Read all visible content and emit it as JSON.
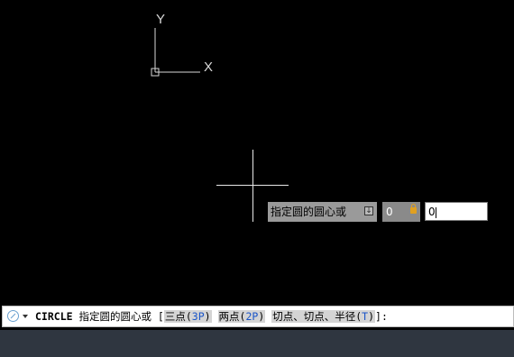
{
  "ucs": {
    "y_label": "Y",
    "x_label": "X"
  },
  "dynamic_input": {
    "prompt": "指定圆的圆心或",
    "field1_value": "0",
    "field2_value": "0"
  },
  "command_line": {
    "command": "CIRCLE",
    "prompt": "指定圆的圆心或",
    "open_bracket": "[",
    "options": [
      {
        "label": "三点(",
        "key": "3P",
        "close": ")"
      },
      {
        "label": "两点(",
        "key": "2P",
        "close": ")"
      },
      {
        "label": "切点、切点、半径(",
        "key": "T",
        "close": ")"
      }
    ],
    "suffix": "]:"
  },
  "colors": {
    "canvas": "#000000",
    "statusbar": "#2f3640",
    "option_key": "#1a55c8"
  }
}
